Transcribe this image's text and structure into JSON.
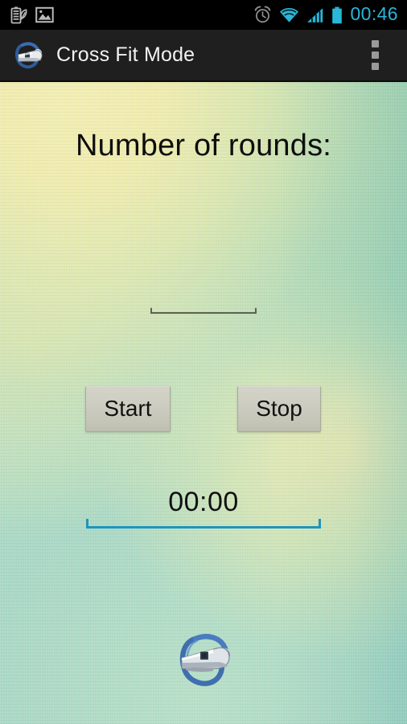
{
  "status_bar": {
    "icons_left": [
      "battery-saver-icon",
      "photo-icon"
    ],
    "icons_right": [
      "alarm-clock-icon",
      "wifi-icon",
      "signal-icon",
      "battery-icon"
    ],
    "clock": "00:46",
    "clock_color": "#29b6d8",
    "background": "#000000"
  },
  "action_bar": {
    "app_icon": "whistle-icon",
    "title": "Cross Fit Mode",
    "overflow_icon": "overflow-menu-icon",
    "background": "#1f1f1f",
    "title_color": "#f2f2f2"
  },
  "main": {
    "rounds_label": "Number of rounds:",
    "rounds_input": {
      "value": "",
      "placeholder": "",
      "underline_color": "#5c6352"
    },
    "start_button": "Start",
    "stop_button": "Stop",
    "timer": {
      "value": "00:00",
      "underline_color": "#1e94bd"
    },
    "bottom_logo": "whistle-icon",
    "background_colors": [
      "#f2eeb4",
      "#b6d9a8",
      "#aedcc6",
      "#9fd2c4"
    ]
  }
}
